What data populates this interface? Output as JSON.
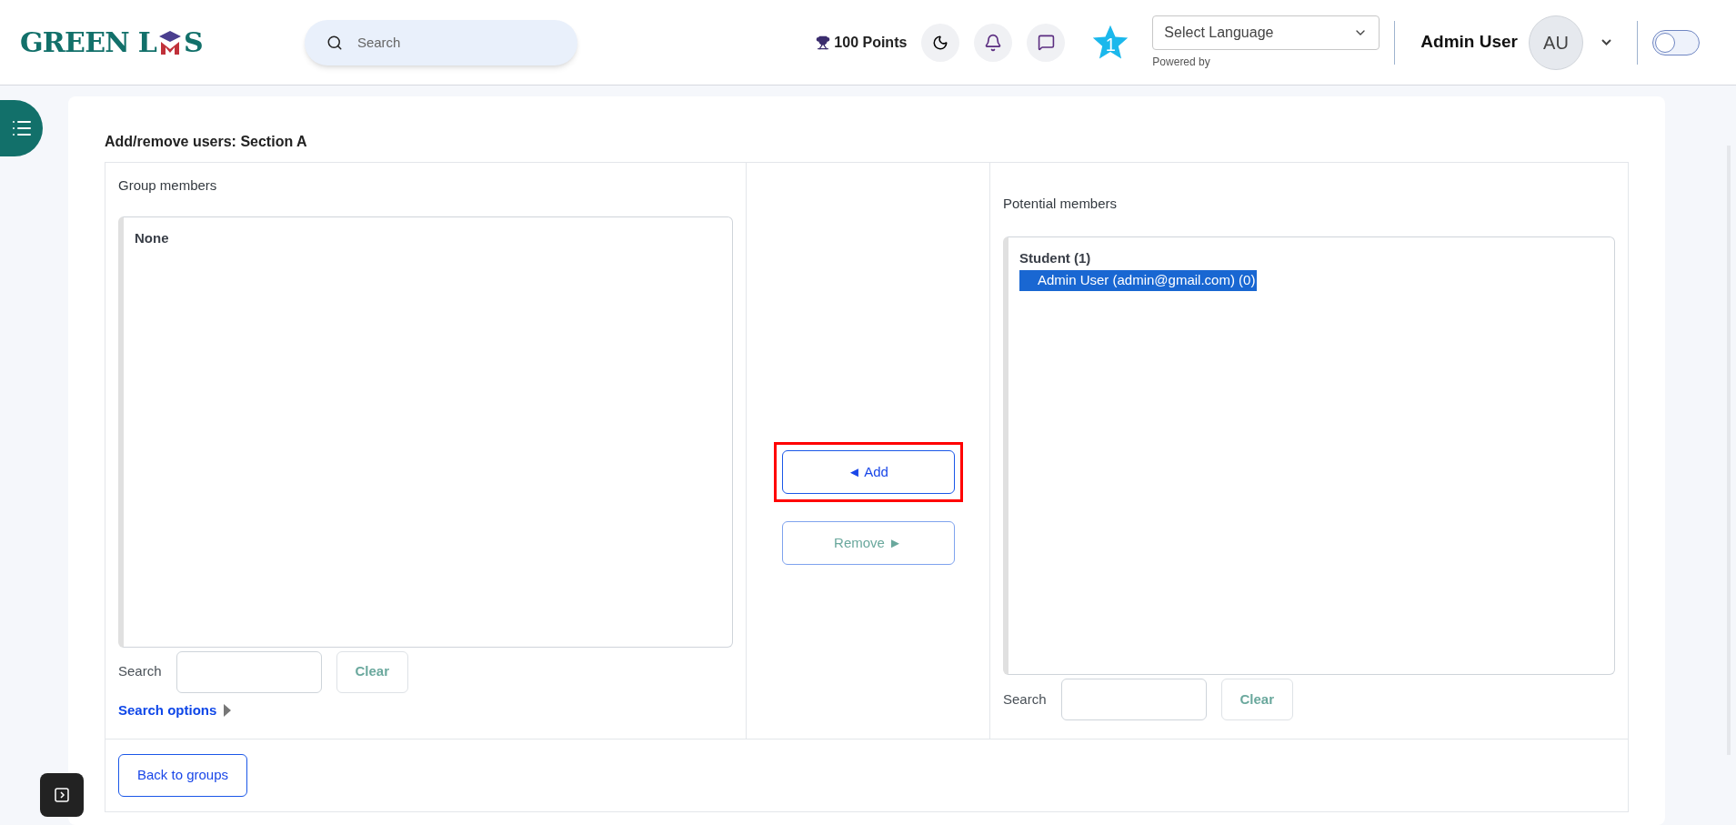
{
  "header": {
    "logo": {
      "part_1": "GREEN L",
      "part_2": "S"
    },
    "search": {
      "placeholder": "Search"
    },
    "points": "100 Points",
    "star_badge": "1",
    "language_select": {
      "value": "Select Language",
      "caption": "Powered by"
    },
    "user": {
      "name": "Admin User",
      "initials": "AU"
    },
    "toggle": {
      "on": false
    }
  },
  "page": {
    "title": "Add/remove users: Section A",
    "group_members": {
      "label": "Group members",
      "list": [
        {
          "kind": "empty",
          "text": "None"
        }
      ],
      "search_label": "Search",
      "clear": "Clear",
      "search_options": "Search options"
    },
    "actions": [
      {
        "label": "◄ Add",
        "highlighted": true,
        "disabled": false
      },
      {
        "label": "Remove ►",
        "highlighted": false,
        "disabled": true
      }
    ],
    "potential_members": {
      "label": "Potential members",
      "list": [
        {
          "kind": "group",
          "text": "Student (1)"
        },
        {
          "kind": "option",
          "text": "Admin User (admin@gmail.com) (0)",
          "selected": true
        }
      ],
      "search_label": "Search",
      "clear": "Clear"
    },
    "back": "Back to groups"
  }
}
